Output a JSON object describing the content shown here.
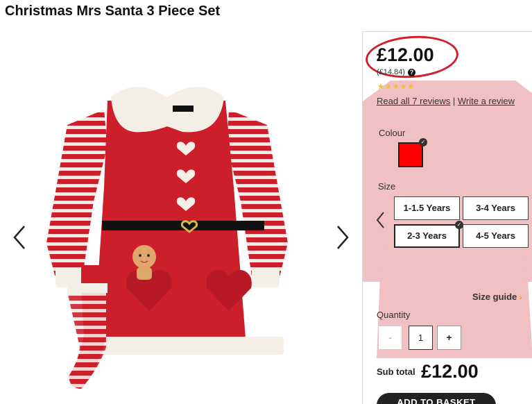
{
  "product": {
    "title": "Christmas Mrs Santa 3 Piece Set"
  },
  "price": {
    "current": "£12.00",
    "was": "(£14.84)",
    "help_glyph": "?"
  },
  "rating": {
    "stars": "★★★★★",
    "value": 5,
    "max": 5
  },
  "reviews": {
    "read_all": "Read all 7 reviews",
    "separator": "|",
    "write": "Write a review"
  },
  "colour": {
    "label": "Colour",
    "selected_color": "#ff0000"
  },
  "size": {
    "label": "Size",
    "options": [
      "1-1.5 Years",
      "3-4 Years",
      "2-3 Years",
      "4-5 Years"
    ],
    "selected": "2-3 Years"
  },
  "size_guide": {
    "label": "Size guide",
    "chevron": "›"
  },
  "quantity": {
    "label": "Quantity",
    "minus": "-",
    "value": "1",
    "plus": "+"
  },
  "subtotal": {
    "label": "Sub total",
    "value": "£12.00"
  },
  "basket": {
    "label": "ADD TO BASKET"
  },
  "colors": {
    "accent_red": "#d21f2b",
    "dress_red": "#cc1f2a",
    "fur_white": "#f4efe6"
  }
}
